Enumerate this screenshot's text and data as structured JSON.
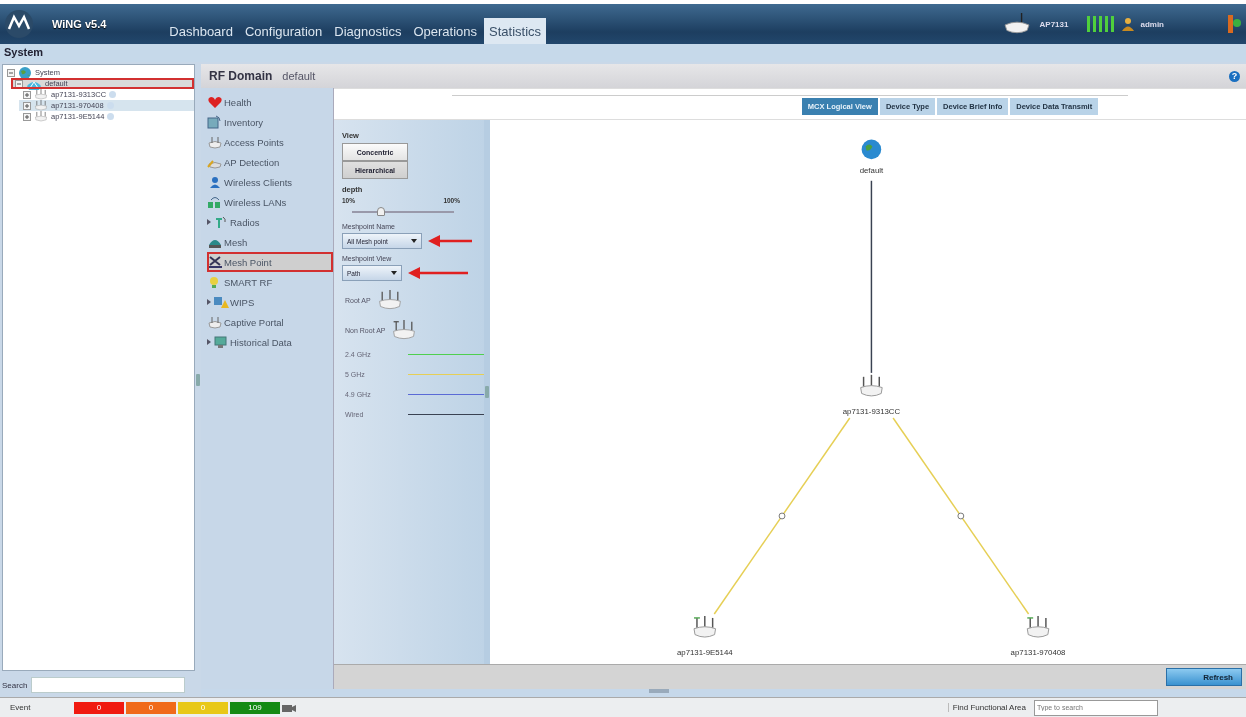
{
  "header": {
    "product": "WiNG v5.4",
    "device": "AP7131",
    "user": "admin",
    "tabs": [
      {
        "label": "Dashboard",
        "selected": false
      },
      {
        "label": "Configuration",
        "selected": false
      },
      {
        "label": "Diagnostics",
        "selected": false
      },
      {
        "label": "Operations",
        "selected": false
      },
      {
        "label": "Statistics",
        "selected": true
      }
    ]
  },
  "breadcrumb": "System",
  "tree": {
    "items": [
      {
        "label": "System",
        "kind": "system",
        "expanded": true,
        "selected": false,
        "outlined": false,
        "children": [
          {
            "label": "default",
            "kind": "domain",
            "expanded": true,
            "selected": true,
            "outlined": true,
            "children": [
              {
                "label": "ap7131-9313CC",
                "kind": "ap",
                "expanded": false,
                "selected": false,
                "outlined": false
              },
              {
                "label": "ap7131-970408",
                "kind": "ap",
                "expanded": false,
                "selected": false,
                "highlighted": true,
                "outlined": false
              },
              {
                "label": "ap7131-9E5144",
                "kind": "ap",
                "expanded": false,
                "selected": false,
                "outlined": false
              }
            ]
          }
        ]
      }
    ],
    "search_label": "Search"
  },
  "rf_domain": {
    "label": "RF Domain",
    "name": "default",
    "help": "?"
  },
  "menu": [
    {
      "label": "Health",
      "kind": "health",
      "expandable": false,
      "selected": false,
      "outlined": false
    },
    {
      "label": "Inventory",
      "kind": "inventory",
      "expandable": false,
      "selected": false,
      "outlined": false
    },
    {
      "label": "Access Points",
      "kind": "ap",
      "expandable": false,
      "selected": false,
      "outlined": false
    },
    {
      "label": "AP Detection",
      "kind": "detect",
      "expandable": false,
      "selected": false,
      "outlined": false
    },
    {
      "label": "Wireless Clients",
      "kind": "client",
      "expandable": false,
      "selected": false,
      "outlined": false
    },
    {
      "label": "Wireless LANs",
      "kind": "wlan",
      "expandable": false,
      "selected": false,
      "outlined": false
    },
    {
      "label": "Radios",
      "kind": "radio",
      "expandable": true,
      "selected": false,
      "outlined": false
    },
    {
      "label": "Mesh",
      "kind": "mesh",
      "expandable": false,
      "selected": false,
      "outlined": false
    },
    {
      "label": "Mesh Point",
      "kind": "meshpoint",
      "expandable": false,
      "selected": true,
      "outlined": true
    },
    {
      "label": "SMART RF",
      "kind": "smartrf",
      "expandable": false,
      "selected": false,
      "outlined": false
    },
    {
      "label": "WIPS",
      "kind": "wips",
      "expandable": true,
      "selected": false,
      "outlined": false
    },
    {
      "label": "Captive Portal",
      "kind": "ap",
      "expandable": false,
      "selected": false,
      "outlined": false
    },
    {
      "label": "Historical Data",
      "kind": "history",
      "expandable": true,
      "selected": false,
      "outlined": false
    }
  ],
  "view_tabs": [
    {
      "label": "MCX Logical View",
      "selected": true
    },
    {
      "label": "Device Type",
      "selected": false
    },
    {
      "label": "Device Brief Info",
      "selected": false
    },
    {
      "label": "Device Data Transmit",
      "selected": false
    }
  ],
  "controls": {
    "view_label": "View",
    "view_buttons": [
      {
        "label": "Concentric",
        "selected": false
      },
      {
        "label": "Hierarchical",
        "selected": true
      }
    ],
    "depth_label": "depth",
    "depth_min": "10%",
    "depth_max": "100%",
    "depth": {
      "level": 0.29
    },
    "meshpoint_name_label": "Meshpoint Name",
    "meshpoint_name": "All Mesh point",
    "meshpoint_view_label": "Meshpoint View",
    "meshpoint_view": "Path",
    "legend_nodes": [
      {
        "label": "Root AP",
        "kind": "root"
      },
      {
        "label": "Non Root AP",
        "kind": "nonroot"
      }
    ],
    "legend_links": [
      {
        "label": "2.4 GHz",
        "kind": "g24",
        "color": "#4fcf4f"
      },
      {
        "label": "5 GHz",
        "kind": "g5",
        "color": "#e6cf55"
      },
      {
        "label": "4.9 GHz",
        "kind": "g49",
        "color": "#5a6ad6"
      },
      {
        "label": "Wired",
        "kind": "wired",
        "color": "#3a4252"
      }
    ]
  },
  "diagram": {
    "root": {
      "label": "default",
      "kind": "domain",
      "children": [
        {
          "label": "ap7131-9313CC",
          "kind": "root",
          "link": {
            "kind": "wired"
          },
          "children": [
            {
              "label": "ap7131-9E5144",
              "kind": "nonroot",
              "link": {
                "kind": "g5"
              }
            },
            {
              "label": "ap7131-970408",
              "kind": "nonroot",
              "link": {
                "kind": "g5"
              }
            }
          ]
        }
      ]
    }
  },
  "refresh": "Refresh",
  "status_bar": {
    "event_label": "Event",
    "events": [
      {
        "count": "0",
        "color": "#f01a10"
      },
      {
        "count": "0",
        "color": "#f06a1a"
      },
      {
        "count": "0",
        "color": "#e8c818"
      },
      {
        "count": "109",
        "color": "#138a13"
      }
    ],
    "find_label": "Find Functional Area",
    "find_placeholder": "Type to search"
  }
}
